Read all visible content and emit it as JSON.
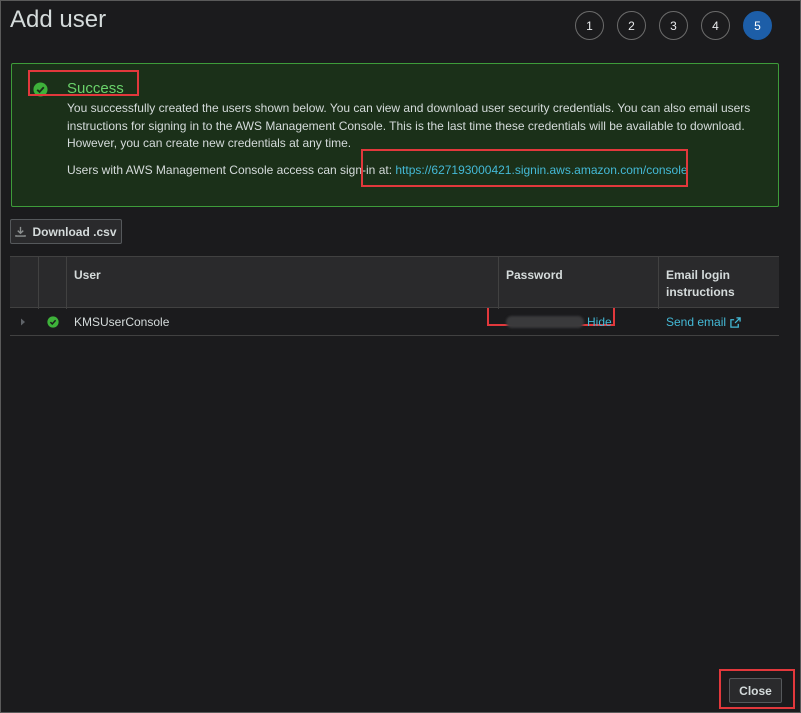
{
  "page": {
    "title": "Add user"
  },
  "steps": [
    "1",
    "2",
    "3",
    "4",
    "5"
  ],
  "alert": {
    "title": "Success",
    "body": "You successfully created the users shown below. You can view and download user security credentials. You can also email users instructions for signing in to the AWS Management Console. This is the last time these credentials will be available to download. However, you can create new credentials at any time.",
    "signin_prefix": "Users with AWS Management Console access can sign-in at: ",
    "signin_url": "https://627193000421.signin.aws.amazon.com/console"
  },
  "actions": {
    "download_label": "Download .csv",
    "close_label": "Close"
  },
  "table": {
    "headers": {
      "user": "User",
      "password": "Password",
      "email_line1": "Email login",
      "email_line2": "instructions"
    },
    "rows": [
      {
        "user": "KMSUserConsole",
        "password_toggle": "Hide",
        "email_action": "Send email"
      }
    ]
  },
  "colors": {
    "success": "#6ad26a",
    "link": "#44b9d6",
    "active_step": "#1d5ea8",
    "highlight": "#e2383c"
  }
}
